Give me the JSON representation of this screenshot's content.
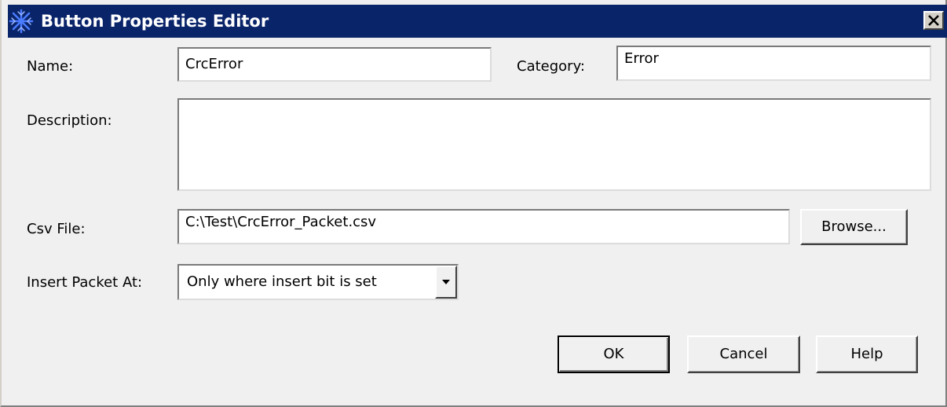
{
  "window": {
    "title": "Button Properties Editor"
  },
  "form": {
    "name_label": "Name:",
    "name_value": "CrcError",
    "category_label": "Category:",
    "category_value": "Error",
    "description_label": "Description:",
    "description_value": "",
    "csv_label": "Csv File:",
    "csv_value": "C:\\Test\\CrcError_Packet.csv",
    "browse_label": "Browse...",
    "insert_label": "Insert Packet At:",
    "insert_selected": "Only where insert bit is set"
  },
  "buttons": {
    "ok": "OK",
    "cancel": "Cancel",
    "help": "Help"
  },
  "colors": {
    "titlebar": "#0a246a",
    "window_bg": "#f0f0f0",
    "field_bg": "#ffffff"
  },
  "icons": {
    "app": "snowflake-icon",
    "close": "close-icon",
    "dropdown": "chevron-down-icon"
  }
}
